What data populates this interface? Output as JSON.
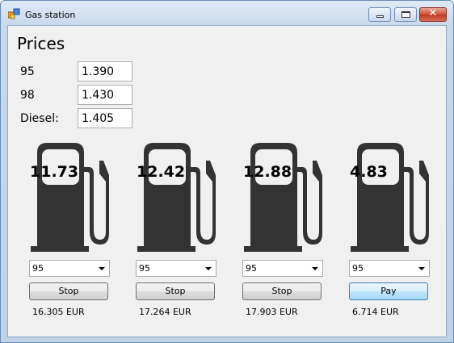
{
  "window": {
    "title": "Gas station",
    "icon": "gas-station-app-icon"
  },
  "caption_buttons": {
    "minimize": "minimize-icon",
    "maximize": "maximize-icon",
    "close": "close-icon"
  },
  "prices": {
    "heading": "Prices",
    "rows": [
      {
        "label": "95",
        "value": "1.390"
      },
      {
        "label": "98",
        "value": "1.430"
      },
      {
        "label": "Diesel:",
        "value": "1.405"
      }
    ]
  },
  "pumps": [
    {
      "amount": "11.73",
      "fuel": "95",
      "button": "Stop",
      "total": "16.305 EUR"
    },
    {
      "amount": "12.42",
      "fuel": "95",
      "button": "Stop",
      "total": "17.264 EUR"
    },
    {
      "amount": "12.88",
      "fuel": "95",
      "button": "Stop",
      "total": "17.903 EUR"
    },
    {
      "amount": "4.83",
      "fuel": "95",
      "button": "Pay",
      "total": "6.714 EUR"
    }
  ],
  "colors": {
    "pump_icon": "#333333",
    "client_background": "#f0f0f0"
  }
}
